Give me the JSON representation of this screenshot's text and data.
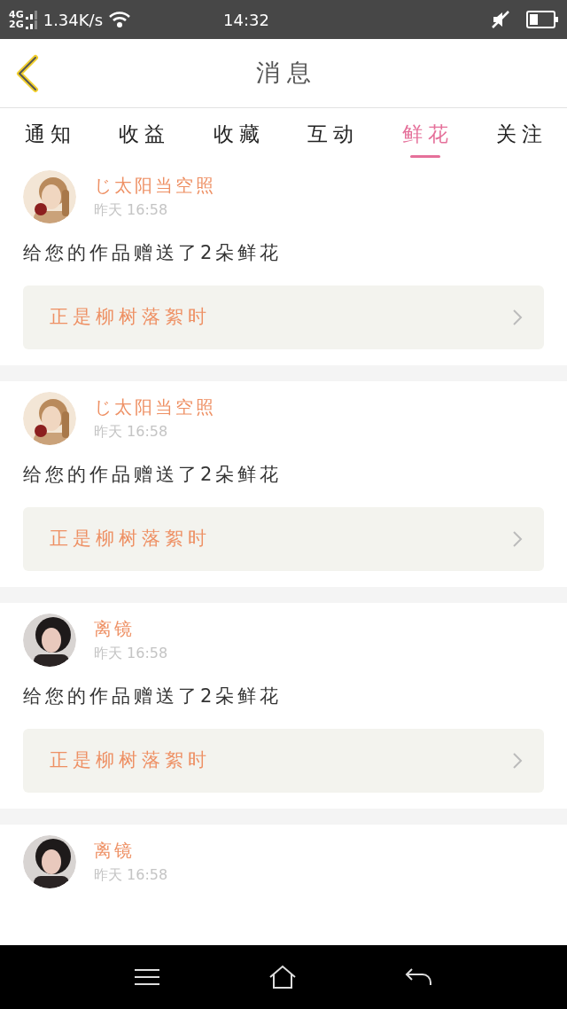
{
  "status_bar": {
    "network_top": "4G",
    "network_bottom": "2G",
    "speed": "1.34K/s",
    "time": "14:32"
  },
  "header": {
    "title": "消息"
  },
  "tabs": [
    {
      "label": "通知",
      "selected": false
    },
    {
      "label": "收益",
      "selected": false
    },
    {
      "label": "收藏",
      "selected": false
    },
    {
      "label": "互动",
      "selected": false
    },
    {
      "label": "鲜花",
      "selected": true
    },
    {
      "label": "关注",
      "selected": false
    }
  ],
  "messages": [
    {
      "name": "じ太阳当空照",
      "time": "昨天 16:58",
      "text": "给您的作品赠送了2朵鲜花",
      "work": "正是柳树落絮时"
    },
    {
      "name": "じ太阳当空照",
      "time": "昨天 16:58",
      "text": "给您的作品赠送了2朵鲜花",
      "work": "正是柳树落絮时"
    },
    {
      "name": "离镜",
      "time": "昨天 16:58",
      "text": "给您的作品赠送了2朵鲜花",
      "work": "正是柳树落絮时"
    },
    {
      "name": "离镜",
      "time": "昨天 16:58"
    }
  ]
}
